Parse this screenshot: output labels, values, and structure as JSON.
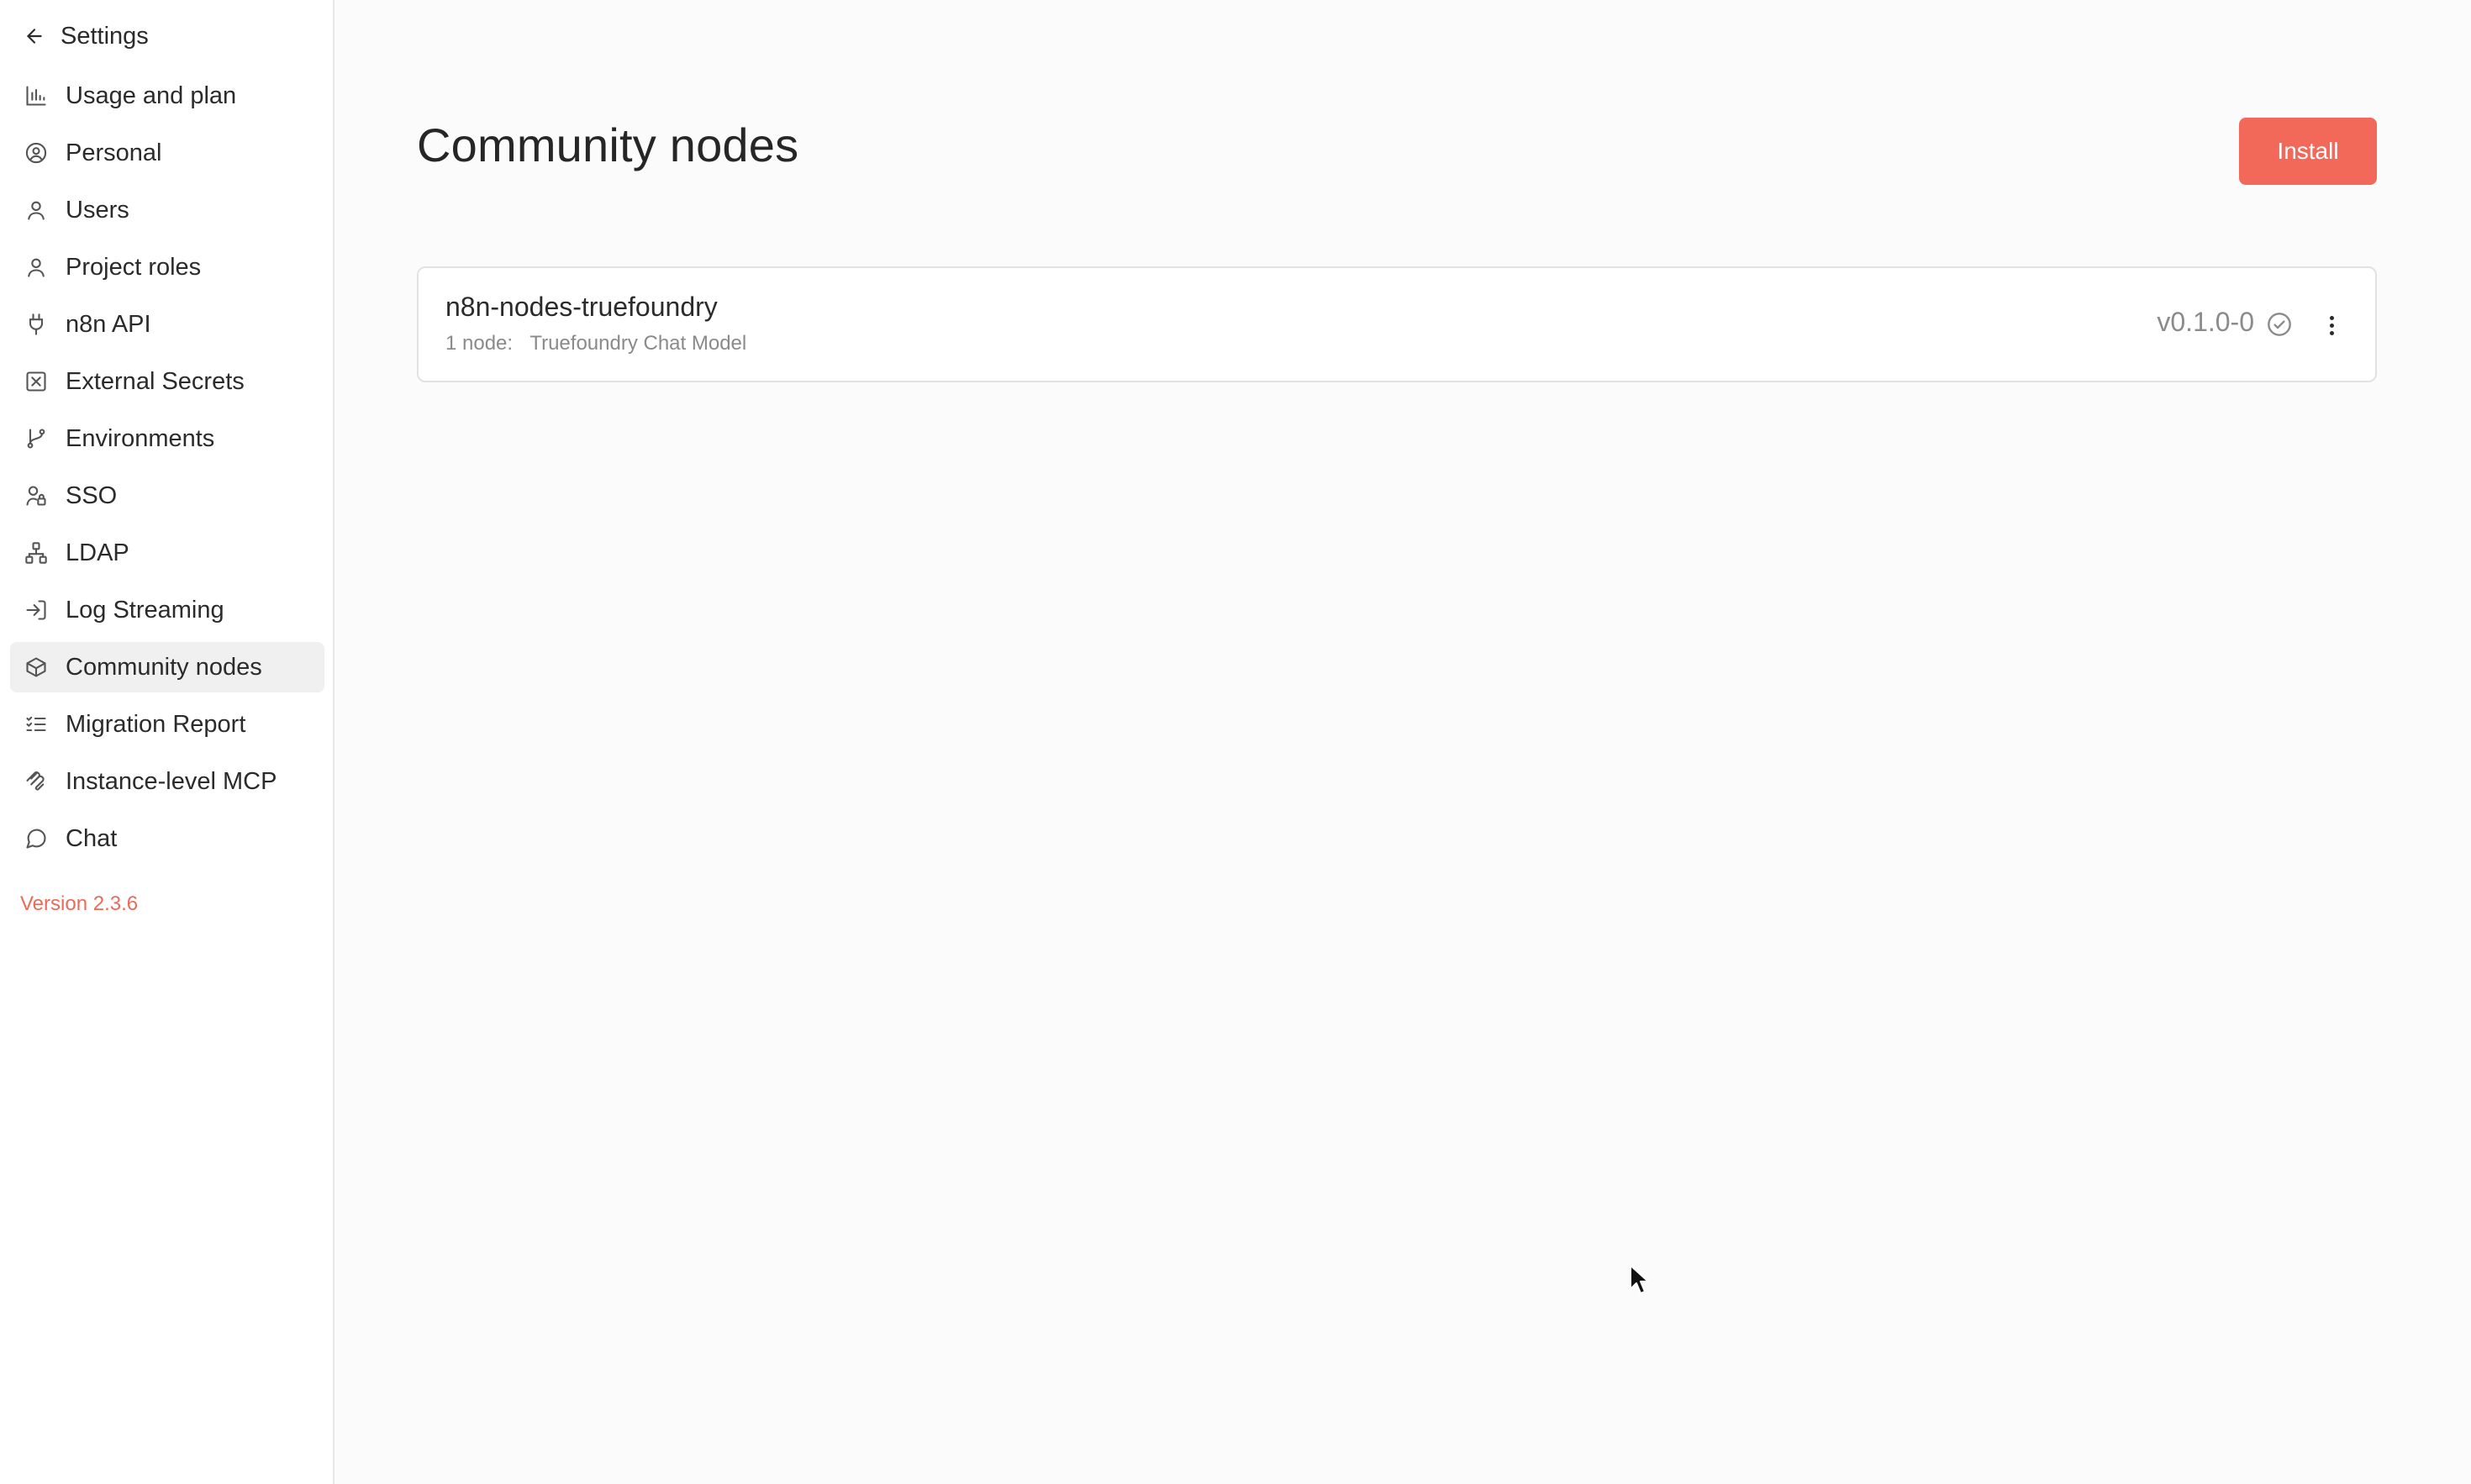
{
  "sidebar": {
    "back_label": "Settings",
    "items": [
      {
        "label": "Usage and plan",
        "icon": "bar-chart-icon"
      },
      {
        "label": "Personal",
        "icon": "user-circle-icon"
      },
      {
        "label": "Users",
        "icon": "user-icon"
      },
      {
        "label": "Project roles",
        "icon": "user-icon"
      },
      {
        "label": "n8n API",
        "icon": "plug-icon"
      },
      {
        "label": "External Secrets",
        "icon": "vault-icon"
      },
      {
        "label": "Environments",
        "icon": "git-branch-icon"
      },
      {
        "label": "SSO",
        "icon": "user-lock-icon"
      },
      {
        "label": "LDAP",
        "icon": "network-icon"
      },
      {
        "label": "Log Streaming",
        "icon": "log-in-icon"
      },
      {
        "label": "Community nodes",
        "icon": "box-icon",
        "active": true
      },
      {
        "label": "Migration Report",
        "icon": "list-checks-icon"
      },
      {
        "label": "Instance-level MCP",
        "icon": "mcp-icon"
      },
      {
        "label": "Chat",
        "icon": "message-circle-icon"
      }
    ],
    "version": "Version 2.3.6"
  },
  "main": {
    "title": "Community nodes",
    "install_label": "Install",
    "nodes": [
      {
        "name": "n8n-nodes-truefoundry",
        "count": "1 node:",
        "node_names": "Truefoundry Chat Model",
        "version": "v0.1.0-0"
      }
    ]
  },
  "colors": {
    "accent": "#f2695a",
    "version_text": "#ea6b59",
    "active_item_bg": "#f0f0f0"
  }
}
